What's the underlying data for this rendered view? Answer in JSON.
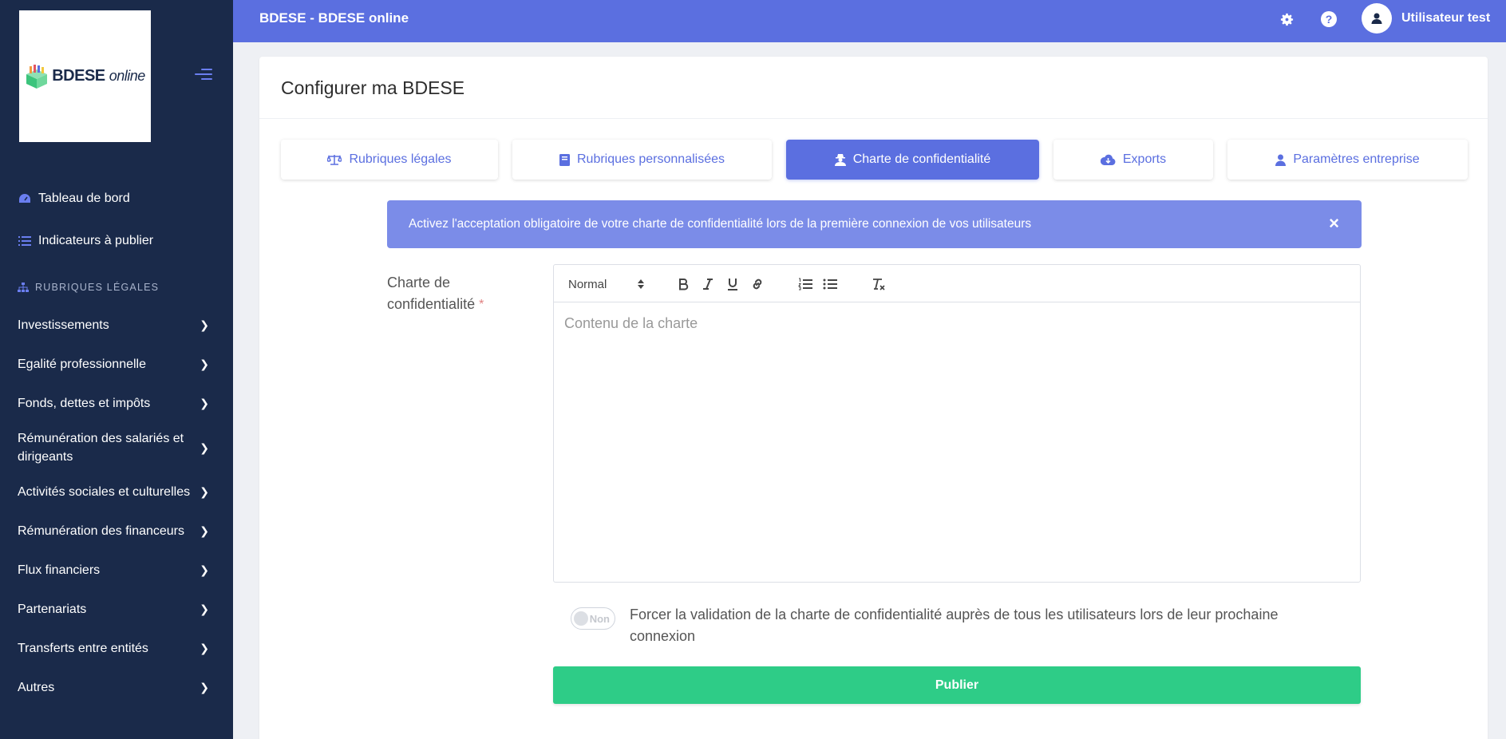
{
  "topbar": {
    "title": "BDESE - BDESE online",
    "settings_icon": "gear-icon",
    "help_icon": "question-icon",
    "user_name": "Utilisateur test"
  },
  "sidebar": {
    "logo": {
      "brand": "BDESE",
      "suffix": "online"
    },
    "top_items": [
      {
        "label": "Tableau de bord",
        "icon": "dashboard-icon"
      },
      {
        "label": "Indicateurs à publier",
        "icon": "list-icon"
      }
    ],
    "section_title": "RUBRIQUES LÉGALES",
    "items": [
      {
        "label": "Investissements"
      },
      {
        "label": "Egalité professionnelle"
      },
      {
        "label": "Fonds, dettes et impôts"
      },
      {
        "label": "Rémunération des salariés et dirigeants"
      },
      {
        "label": "Activités sociales et culturelles"
      },
      {
        "label": "Rémunération des financeurs"
      },
      {
        "label": "Flux financiers"
      },
      {
        "label": "Partenariats"
      },
      {
        "label": "Transferts entre entités"
      },
      {
        "label": "Autres"
      }
    ]
  },
  "page": {
    "title": "Configurer ma BDESE"
  },
  "tabs": [
    {
      "label": "Rubriques légales",
      "icon": "scale-icon",
      "active": false
    },
    {
      "label": "Rubriques personnalisées",
      "icon": "book-icon",
      "active": false
    },
    {
      "label": "Charte de confidentialité",
      "icon": "user-secret-icon",
      "active": true
    },
    {
      "label": "Exports",
      "icon": "cloud-download-icon",
      "active": false
    },
    {
      "label": "Paramètres entreprise",
      "icon": "user-icon",
      "active": false
    }
  ],
  "alert": {
    "text": "Activez l'acceptation obligatoire de votre charte de confidentialité lors de la première connexion de vos utilisateurs",
    "close": "×"
  },
  "form": {
    "label": "Charte de confidentialité",
    "required_mark": "*",
    "editor": {
      "format_value": "Normal",
      "placeholder": "Contenu de la charte"
    },
    "toggle": {
      "state_label": "Non",
      "checked": false,
      "text": "Forcer la validation de la charte de confidentialité auprès de tous les utilisateurs lors de leur prochaine connexion"
    },
    "submit_label": "Publier"
  },
  "colors": {
    "primary": "#5b6fe0",
    "sidebar": "#1a2a4a",
    "alert": "#7b8ce8",
    "success": "#2ecc87"
  }
}
